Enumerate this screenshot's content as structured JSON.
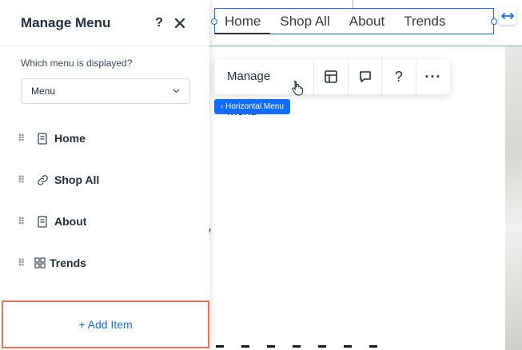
{
  "panel": {
    "title": "Manage Menu",
    "help_label": "?",
    "field_label": "Which menu is displayed?",
    "dropdown_value": "Menu",
    "items": [
      {
        "label": "Home",
        "icon": "page-icon"
      },
      {
        "label": "Shop All",
        "icon": "link-icon"
      },
      {
        "label": "About",
        "icon": "page-icon"
      },
      {
        "label": "Trends",
        "icon": "dynamic-page-icon"
      }
    ],
    "add_item_label": "+ Add Item"
  },
  "canvas_menu": {
    "items": [
      "Home",
      "Shop All",
      "About",
      "Trends"
    ],
    "active": "Home"
  },
  "toolbar": {
    "manage_label": "Manage Menu",
    "icons": [
      "layout-icon",
      "comment-icon",
      "help-icon",
      "more-icon"
    ],
    "help_label": "?",
    "more_label": "···"
  },
  "breadcrumb": {
    "label": "‹ Horizontal Menu"
  },
  "colors": {
    "accent": "#116dff",
    "highlight": "#e8735a",
    "guide": "#6fbf8a"
  }
}
